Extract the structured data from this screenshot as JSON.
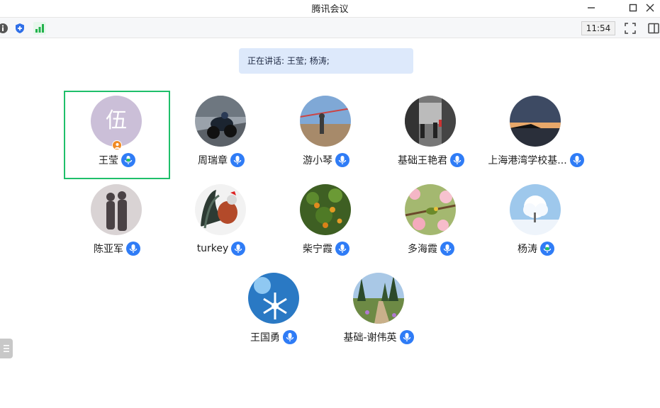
{
  "window": {
    "title": "腾讯会议"
  },
  "toolbar": {
    "clock": "11:54"
  },
  "speaking": {
    "text": "正在讲话: 王莹; 杨涛;"
  },
  "participants": [
    {
      "name": "王莹",
      "avatar_text": "伍",
      "mic": "speaking"
    },
    {
      "name": "周瑞章",
      "mic": "on"
    },
    {
      "name": "游小琴",
      "mic": "on"
    },
    {
      "name": "基础王艳君",
      "mic": "on"
    },
    {
      "name": "上海港湾学校基...",
      "mic": "on"
    },
    {
      "name": "陈亚军",
      "mic": "on"
    },
    {
      "name": "turkey",
      "mic": "on"
    },
    {
      "name": "柴宁霞",
      "mic": "on"
    },
    {
      "name": "多海霞",
      "mic": "on"
    },
    {
      "name": "杨涛",
      "mic": "speaking"
    },
    {
      "name": "王国勇",
      "mic": "on"
    },
    {
      "name": "基础-谢伟英",
      "mic": "on"
    }
  ],
  "colors": {
    "active_border": "#1fbf6a",
    "mic_blue": "#2f7cf6",
    "mic_speaking": "#22c55e",
    "speaking_bg": "#dde9fb"
  }
}
